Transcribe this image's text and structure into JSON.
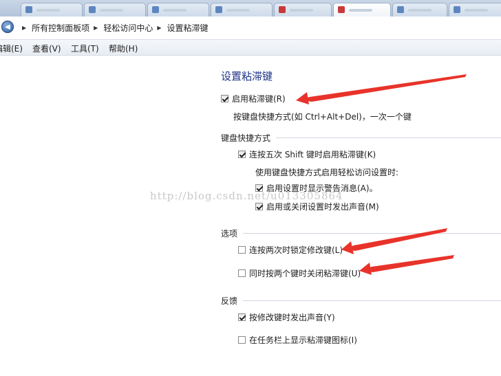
{
  "breadcrumb": {
    "items": [
      "所有控制面板项",
      "轻松访问中心",
      "设置粘滞键"
    ]
  },
  "menubar": {
    "items": [
      "编辑(E)",
      "查看(V)",
      "工具(T)",
      "帮助(H)"
    ]
  },
  "page_title": "设置粘滞键",
  "enable_sticky": {
    "label": "启用粘滞键(R)",
    "checked": true,
    "hint": "按键盘快捷方式(如 Ctrl+Alt+Del)，一次一个键"
  },
  "keyboard_shortcut": {
    "heading": "键盘快捷方式",
    "shift_five": {
      "label": "连按五次 Shift 键时启用粘滞键(K)",
      "checked": true
    },
    "subheading": "使用键盘快捷方式启用轻松访问设置时:",
    "show_warning": {
      "label": "启用设置时显示警告消息(A)。",
      "checked": true
    },
    "play_sound": {
      "label": "启用或关闭设置时发出声音(M)",
      "checked": true
    }
  },
  "options": {
    "heading": "选项",
    "lock_modifier": {
      "label": "连按两次时锁定修改键(L)",
      "checked": false
    },
    "two_keys_off": {
      "label": "同时按两个键时关闭粘滞键(U)",
      "checked": false
    }
  },
  "feedback": {
    "heading": "反馈",
    "modifier_sound": {
      "label": "按修改键时发出声音(Y)",
      "checked": true
    },
    "taskbar_icon": {
      "label": "在任务栏上显示粘滞键图标(I)",
      "checked": false
    }
  },
  "watermark": "http://blog.csdn.net/u013305864",
  "colors": {
    "title": "#1e3287",
    "annotation_arrow": "#e8332a"
  },
  "icons": {
    "back": "back-arrow-icon",
    "separator": "chevron-right-icon"
  }
}
